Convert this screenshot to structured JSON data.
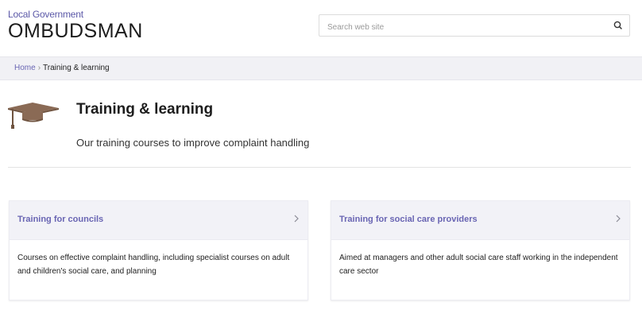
{
  "header": {
    "logo_small": "Local Government",
    "logo_big": "OMBUDSMAN",
    "search_placeholder": "Search web site"
  },
  "breadcrumb": {
    "home": "Home",
    "separator": "›",
    "current": "Training & learning"
  },
  "page": {
    "title": "Training & learning",
    "subtitle": "Our training courses to improve complaint handling",
    "icon": "graduation-cap-icon"
  },
  "cards": [
    {
      "title": "Training for councils",
      "description": "Courses on effective complaint handling, including specialist courses on adult and children's social care, and planning"
    },
    {
      "title": "Training for social care providers",
      "description": "Aimed at managers and other adult social care staff working in the independent care sector"
    }
  ],
  "colors": {
    "accent": "#6965b3",
    "cap": "#8a6a55"
  }
}
